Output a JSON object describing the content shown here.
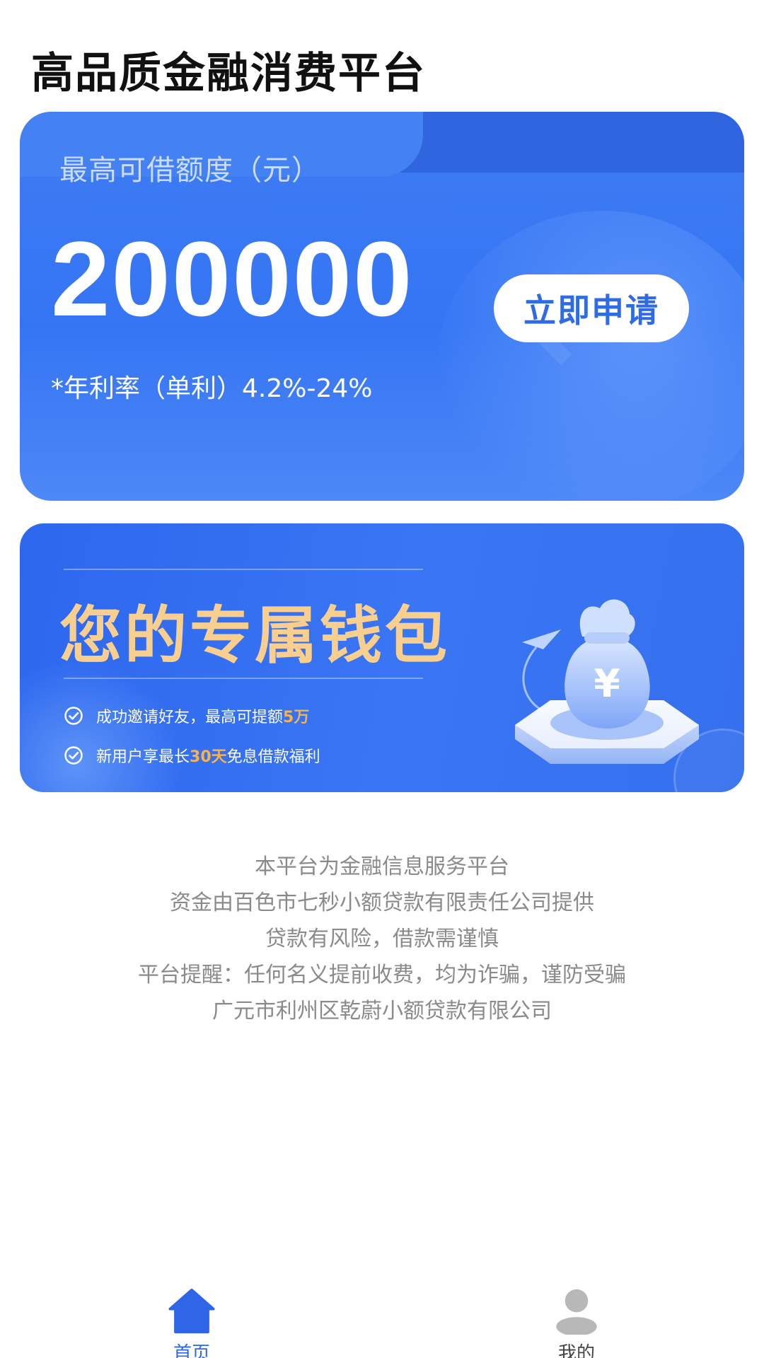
{
  "header": {
    "title": "高品质金融消费平台"
  },
  "loan_card": {
    "label": "最高可借额度（元）",
    "amount": "200000",
    "apply_button": "立即申请",
    "rate": "*年利率（单利）4.2%-24%"
  },
  "wallet_banner": {
    "title": "您的专属钱包",
    "feature_1": {
      "text": "成功邀请好友，最高可提额",
      "highlight": "5万"
    },
    "feature_2": {
      "text_before": "新用户享最长",
      "highlight": "30天",
      "text_after": "免息借款福利"
    }
  },
  "disclaimer": {
    "lines": [
      "本平台为金融信息服务平台",
      "资金由百色市七秒小额贷款有限责任公司提供",
      "贷款有风险，借款需谨慎",
      "平台提醒：任何名义提前收费，均为诈骗，谨防受骗",
      "广元市利州区乾蔚小额贷款有限公司"
    ]
  },
  "bottom_nav": {
    "items": [
      {
        "label": "首页",
        "icon": "home-icon",
        "active": true
      },
      {
        "label": "我的",
        "icon": "user-icon",
        "active": false
      }
    ]
  },
  "colors": {
    "primary_blue": "#3575f4",
    "wallet_gold": "#f8cf8f",
    "highlight_orange": "#f7b24a",
    "nav_active": "#2f66e8",
    "disclaimer_gray": "#8a8a8a"
  }
}
